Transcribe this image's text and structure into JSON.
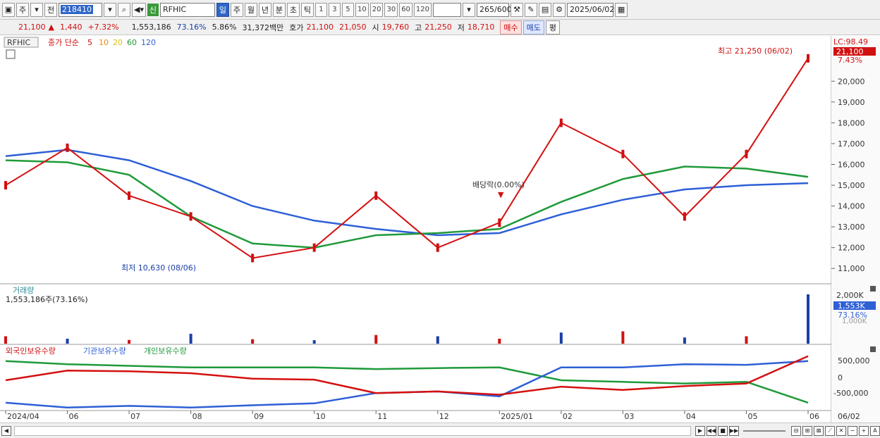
{
  "toolbar": {
    "chart_type": "주",
    "prev_label": "전",
    "code": "218410",
    "name": "RFHIC",
    "new_badge": "신",
    "periods": [
      "일",
      "주",
      "월",
      "년",
      "분",
      "초",
      "틱"
    ],
    "selected_period": "일",
    "numbers": [
      "1",
      "3",
      "5",
      "10",
      "20",
      "30",
      "60",
      "120"
    ],
    "count": "265",
    "max_count": "/600",
    "date": "2025/06/02"
  },
  "quote": {
    "price": "21,100",
    "change_arrow": "▲",
    "change": "1,440",
    "change_pct": "+7.32%",
    "volume": "1,553,186",
    "vol_ratio": "73.16%",
    "turnover": "5.86%",
    "amount": "31,372백만",
    "bid_label": "호가",
    "bid1": "21,100",
    "bid2": "21,050",
    "open_label": "시",
    "open": "19,760",
    "high_label": "고",
    "high": "21,250",
    "low_label": "저",
    "low": "18,710",
    "buy_label": "매수",
    "sell_label": "매도",
    "eval_label": "평"
  },
  "colors": {
    "up": "#d01010",
    "down": "#1a3ea8",
    "ma5": "#d41010",
    "ma10": "#f08a10",
    "ma20": "#e6d020",
    "ma60": "#1f9a3a",
    "ma120": "#2e5fd6"
  },
  "price_panel": {
    "code_tag": "RFHIC",
    "legend_title": "종가 단순",
    "ma_periods": [
      "5",
      "10",
      "20",
      "60",
      "120"
    ],
    "lc_label": "LC:98.49",
    "current_tag": "21,100",
    "current_pct": "7.43%",
    "y_ticks": [
      "20,000",
      "19,000",
      "18,000",
      "17,000",
      "16,000",
      "15,000",
      "14,000",
      "13,000",
      "12,000",
      "11,000"
    ],
    "annotations": {
      "high": "최고 21,250 (06/02)",
      "low": "최저 10,630 (08/06)",
      "dividend": "배당락(0.00%)"
    }
  },
  "volume_panel": {
    "title": "거래량",
    "value": "1,553,186주(73.16%)",
    "y_ticks": [
      "2,000K",
      "1,000K"
    ],
    "current_tag": "1,553K",
    "current_pct": "73.16%"
  },
  "holding_panel": {
    "legend": [
      "외국인보유수량",
      "기관보유수량",
      "개인보유수량"
    ],
    "y_ticks": [
      "500,000",
      "0",
      "-500,000"
    ]
  },
  "x_axis": {
    "labels": [
      "2024/04",
      "06",
      "07",
      "08",
      "09",
      "10",
      "11",
      "12",
      "2025/01",
      "02",
      "03",
      "04",
      "05",
      "06"
    ],
    "right_label": "06/02"
  },
  "chart_data": {
    "type": "line",
    "price_series": {
      "name": "종가",
      "x": [
        "2024/04",
        "06",
        "07",
        "08",
        "09",
        "10",
        "11",
        "12",
        "2025/01",
        "02",
        "03",
        "04",
        "05",
        "06"
      ],
      "values": [
        15000,
        16800,
        14500,
        13500,
        11500,
        12000,
        14500,
        12000,
        13200,
        18000,
        16500,
        13500,
        16500,
        21100
      ]
    },
    "ma120": {
      "name": "120",
      "values": [
        16400,
        16700,
        16200,
        15200,
        14000,
        13300,
        12900,
        12600,
        12700,
        13600,
        14300,
        14800,
        15000,
        15100
      ]
    },
    "ma60": {
      "name": "60",
      "values": [
        16200,
        16100,
        15500,
        13500,
        12200,
        12000,
        12600,
        12700,
        12900,
        14200,
        15300,
        15900,
        15800,
        15400
      ]
    },
    "volume_values": [
      300,
      200,
      150,
      400,
      180,
      140,
      350,
      300,
      200,
      450,
      500,
      250,
      300,
      2000
    ],
    "holdings": {
      "foreign": {
        "name": "외국인보유수량",
        "values": [
          -100000,
          200000,
          180000,
          120000,
          -50000,
          -80000,
          -500000,
          -450000,
          -550000,
          -300000,
          -400000,
          -280000,
          -200000,
          650000
        ]
      },
      "institution": {
        "name": "기관보유수량",
        "values": [
          -800000,
          -950000,
          -900000,
          -950000,
          -880000,
          -820000,
          -500000,
          -450000,
          -600000,
          300000,
          300000,
          400000,
          380000,
          500000
        ]
      },
      "individual": {
        "name": "개인보유수량",
        "values": [
          500000,
          400000,
          350000,
          300000,
          300000,
          300000,
          250000,
          280000,
          300000,
          -100000,
          -150000,
          -200000,
          -150000,
          -800000
        ]
      }
    },
    "y_range_price": [
      10500,
      21500
    ],
    "y_range_holding": [
      -1000000,
      800000
    ]
  }
}
